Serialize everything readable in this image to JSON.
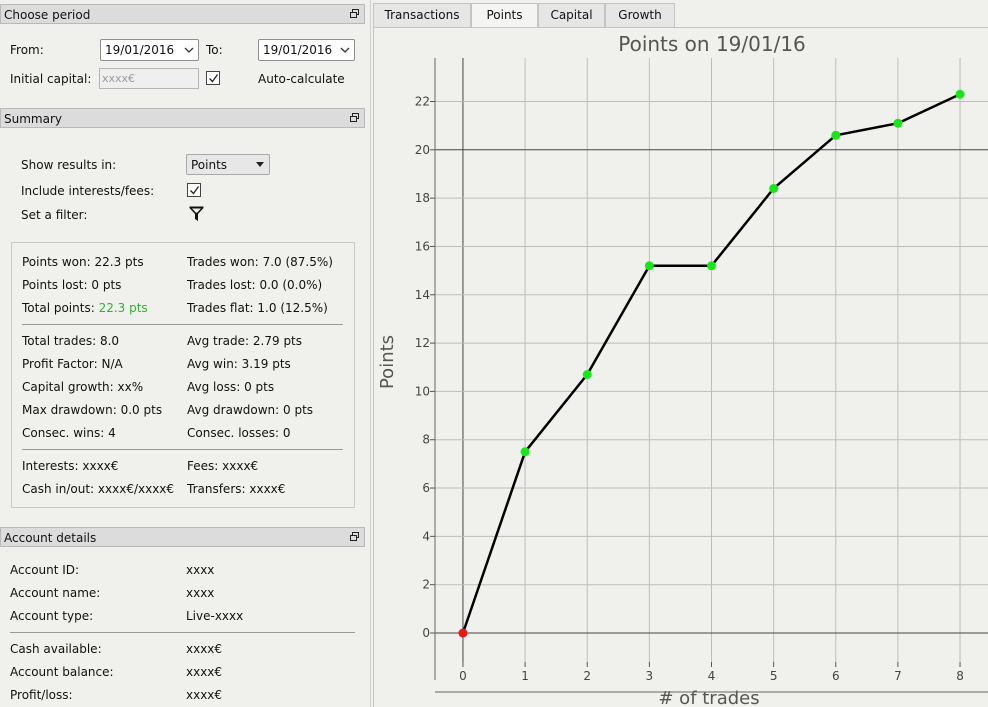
{
  "choose_period": {
    "title": "Choose period",
    "from_label": "From:",
    "from_value": "19/01/2016",
    "to_label": "To:",
    "to_value": "19/01/2016",
    "initial_capital_label": "Initial capital:",
    "initial_capital_placeholder": "xxxx€",
    "auto_calculate_checked": true,
    "auto_calculate_label": "Auto-calculate"
  },
  "summary": {
    "title": "Summary",
    "show_results_label": "Show results in:",
    "show_results_value": "Points",
    "include_interests_label": "Include interests/fees:",
    "include_interests_checked": true,
    "set_filter_label": "Set a filter:",
    "stats_left": [
      {
        "label": "Points won:",
        "value": "22.3 pts"
      },
      {
        "label": "Points lost:",
        "value": "0 pts"
      },
      {
        "label": "Total points:",
        "value": "22.3 pts"
      }
    ],
    "stats_right": [
      {
        "label": "Trades won:",
        "value": "7.0 (87.5%)"
      },
      {
        "label": "Trades lost:",
        "value": "0.0 (0.0%)"
      },
      {
        "label": "Trades flat:",
        "value": "1.0 (12.5%)"
      }
    ],
    "stats2_left": [
      {
        "label": "Total trades:",
        "value": "8.0"
      },
      {
        "label": "Profit Factor:",
        "value": "N/A"
      },
      {
        "label": "Capital growth:",
        "value": "xx%"
      },
      {
        "label": "Max drawdown:",
        "value": "0.0 pts"
      },
      {
        "label": "Consec. wins:",
        "value": "4"
      }
    ],
    "stats2_right": [
      {
        "label": "Avg trade:",
        "value": "2.79 pts"
      },
      {
        "label": "Avg win:",
        "value": "3.19 pts"
      },
      {
        "label": "Avg loss:",
        "value": "0 pts"
      },
      {
        "label": "Avg drawdown:",
        "value": "0 pts"
      },
      {
        "label": "Consec. losses:",
        "value": "0"
      }
    ],
    "stats3_left": [
      {
        "label": "Interests:",
        "value": "xxxx€"
      },
      {
        "label": "Cash in/out:",
        "value": "xxxx€/xxxx€"
      }
    ],
    "stats3_right": [
      {
        "label": "Fees:",
        "value": "xxxx€"
      },
      {
        "label": "Transfers:",
        "value": "xxxx€"
      }
    ]
  },
  "account": {
    "title": "Account details",
    "rows1": [
      {
        "label": "Account ID:",
        "value": "xxxx"
      },
      {
        "label": "Account name:",
        "value": "xxxx"
      },
      {
        "label": "Account type:",
        "value": "Live-xxxx"
      }
    ],
    "rows2": [
      {
        "label": "Cash available:",
        "value": "xxxx€"
      },
      {
        "label": "Account balance:",
        "value": "xxxx€"
      },
      {
        "label": "Profit/loss:",
        "value": "xxxx€"
      }
    ]
  },
  "tabs": [
    "Transactions",
    "Points",
    "Capital",
    "Growth"
  ],
  "active_tab": 1,
  "colors": {
    "green_text": "#2db32d",
    "point_green": "#19e619",
    "point_red": "#e61919"
  },
  "chart_data": {
    "type": "line",
    "title": "Points on 19/01/16",
    "xlabel": "# of trades",
    "ylabel": "Points",
    "x": [
      0,
      1,
      2,
      3,
      4,
      5,
      6,
      7,
      8
    ],
    "values": [
      0,
      7.5,
      10.7,
      15.2,
      15.2,
      18.4,
      20.6,
      21.1,
      22.3
    ],
    "xlim": [
      -0.45,
      8.45
    ],
    "ylim": [
      -1.2,
      23.8
    ],
    "xticks": [
      "0",
      "1",
      "2",
      "3",
      "4",
      "5",
      "6",
      "7",
      "8"
    ],
    "yticks": [
      "0",
      "2",
      "4",
      "6",
      "8",
      "10",
      "12",
      "14",
      "16",
      "18",
      "20",
      "22"
    ],
    "grid": true
  }
}
